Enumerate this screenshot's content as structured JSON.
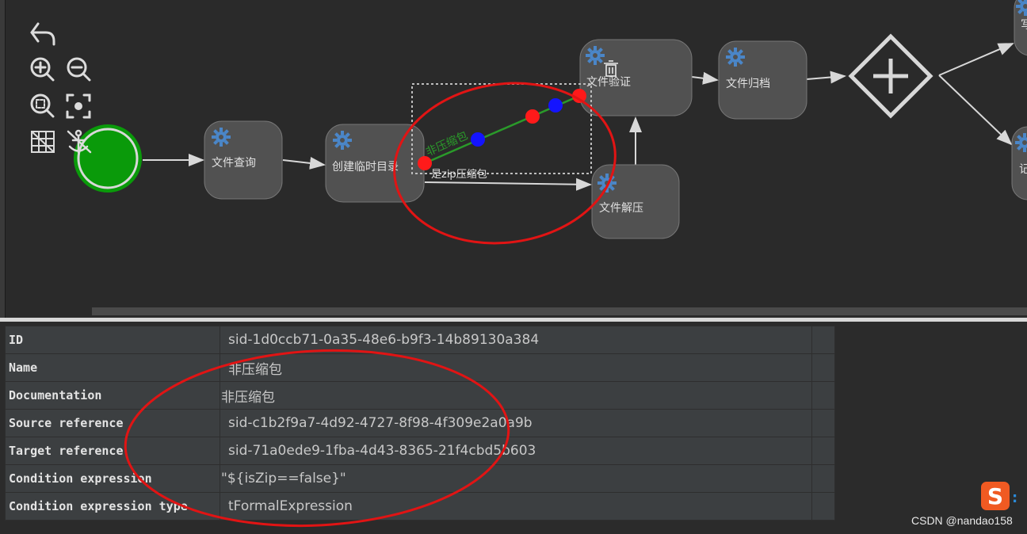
{
  "toolbar": {
    "undo": "undo-icon",
    "zoom_in": "zoom-in-icon",
    "zoom_out": "zoom-out-icon",
    "zoom_fit": "zoom-fit-icon",
    "zoom_actual": "zoom-actual-icon",
    "grid": "grid-icon",
    "anchor": "anchor-icon"
  },
  "diagram": {
    "tasks": {
      "query": "文件查询",
      "create_dir": "创建临时目录",
      "verify": "文件验证",
      "archive": "文件归档",
      "unzip": "文件解压",
      "right_top_partial": "写",
      "right_bottom_partial": "记"
    },
    "flows": {
      "non_zip": "非压缩包",
      "is_zip": "是zip压缩包"
    }
  },
  "properties": [
    {
      "key": "ID",
      "value": "sid-1d0ccb71-0a35-48e6-b9f3-14b89130a384"
    },
    {
      "key": "Name",
      "value": "非压缩包"
    },
    {
      "key": "Documentation",
      "value": "非压缩包"
    },
    {
      "key": "Source reference",
      "value": "sid-c1b2f9a7-4d92-4727-8f98-4f309e2a0a9b"
    },
    {
      "key": "Target reference",
      "value": "sid-71a0ede9-1fba-4d43-8365-21f4cbd5b603"
    },
    {
      "key": "Condition expression",
      "value": "\"${isZip==false}\""
    },
    {
      "key": "Condition expression type",
      "value": "tFormalExpression"
    }
  ],
  "watermark": "CSDN @nandao158",
  "colors": {
    "canvas_bg": "#2a2a2a",
    "start_event": "#0a9a0a",
    "task_fill": "#515151",
    "gear": "#4a86c8",
    "selected_flow": "#2a9a2a",
    "annotation": "#e11414"
  }
}
